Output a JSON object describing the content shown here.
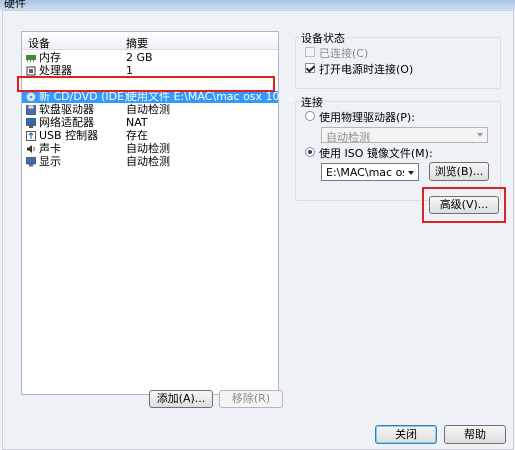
{
  "window": {
    "title": "硬件"
  },
  "device_list": {
    "headers": {
      "device": "设备",
      "summary": "摘要"
    },
    "rows": [
      {
        "icon": "memory-icon",
        "name": "内存",
        "summary": "2 GB"
      },
      {
        "icon": "processor-icon",
        "name": "处理器",
        "summary": "1"
      },
      {
        "icon": "cd-dvd-icon",
        "name": "新 CD/DVD (IDE)",
        "summary": "使用文件 E:\\MAC\\mac osx 10...."
      },
      {
        "icon": "floppy-icon",
        "name": "软盘驱动器",
        "summary": "自动检测"
      },
      {
        "icon": "network-icon",
        "name": "网络适配器",
        "summary": "NAT"
      },
      {
        "icon": "usb-icon",
        "name": "USB 控制器",
        "summary": "存在"
      },
      {
        "icon": "sound-icon",
        "name": "声卡",
        "summary": "自动检测"
      },
      {
        "icon": "display-icon",
        "name": "显示",
        "summary": "自动检测"
      }
    ],
    "selected_index": 2
  },
  "buttons": {
    "add": "添加(A)...",
    "remove": "移除(R)",
    "close": "关闭",
    "help": "帮助",
    "browse": "浏览(B)...",
    "advanced": "高级(V)..."
  },
  "device_status": {
    "title": "设备状态",
    "connected": {
      "label": "已连接(C)",
      "checked": false,
      "disabled": true
    },
    "connect_at_power_on": {
      "label": "打开电源时连接(O)",
      "checked": true
    }
  },
  "connection": {
    "title": "连接",
    "physical_drive": {
      "label": "使用物理驱动器(P):",
      "selected": false
    },
    "physical_drive_value": "自动检测",
    "iso_file": {
      "label": "使用 ISO 镜像文件(M):",
      "selected": true
    },
    "iso_path": "E:\\MAC\\mac osx 10"
  },
  "colors": {
    "selection": "#3399ff",
    "highlight": "#e02020"
  }
}
